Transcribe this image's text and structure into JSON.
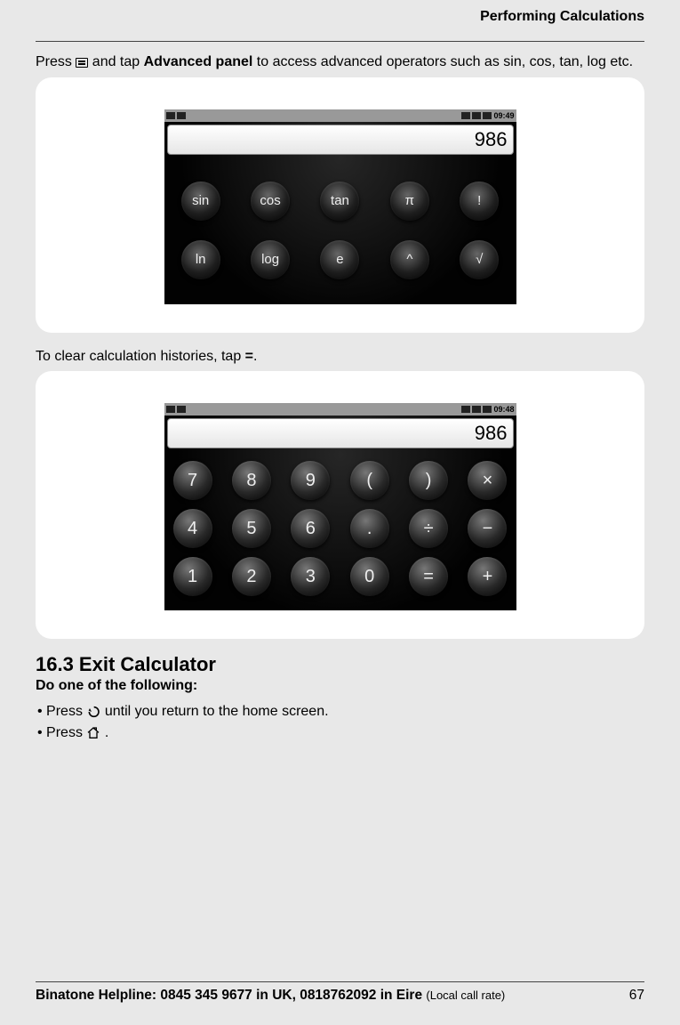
{
  "header": {
    "title": "Performing Calculations"
  },
  "text": {
    "press": "Press ",
    "advanced_post_icon": " and tap ",
    "advanced_panel": "Advanced panel",
    "advanced_rest": " to access advanced operators such as sin, cos, tan, log etc.",
    "clear_history_pre": "To clear calculation histories, tap ",
    "equals_bold": "=",
    "clear_history_post": "."
  },
  "screenshot1": {
    "time": "09:49",
    "display": "986",
    "rows": [
      [
        "sin",
        "cos",
        "tan",
        "π",
        "!"
      ],
      [
        "ln",
        "log",
        "e",
        "^",
        "√"
      ]
    ]
  },
  "screenshot2": {
    "time": "09:48",
    "display": "986",
    "rows": [
      [
        "7",
        "8",
        "9",
        "(",
        ")",
        "×"
      ],
      [
        "4",
        "5",
        "6",
        ".",
        "÷",
        "−"
      ],
      [
        "1",
        "2",
        "3",
        "0",
        "=",
        "+"
      ]
    ]
  },
  "section": {
    "number_title": "16.3   Exit Calculator",
    "subhead": "Do one of the following:",
    "bullet1_pre": "Press ",
    "bullet1_post": "  until you return to the home screen.",
    "bullet2_pre": "Press ",
    "bullet2_post": " ."
  },
  "footer": {
    "helpline_bold": "Binatone Helpline: 0845 345 9677 in UK, 0818762092 in Eire ",
    "helpline_small": "(Local call rate)",
    "page": "67"
  }
}
